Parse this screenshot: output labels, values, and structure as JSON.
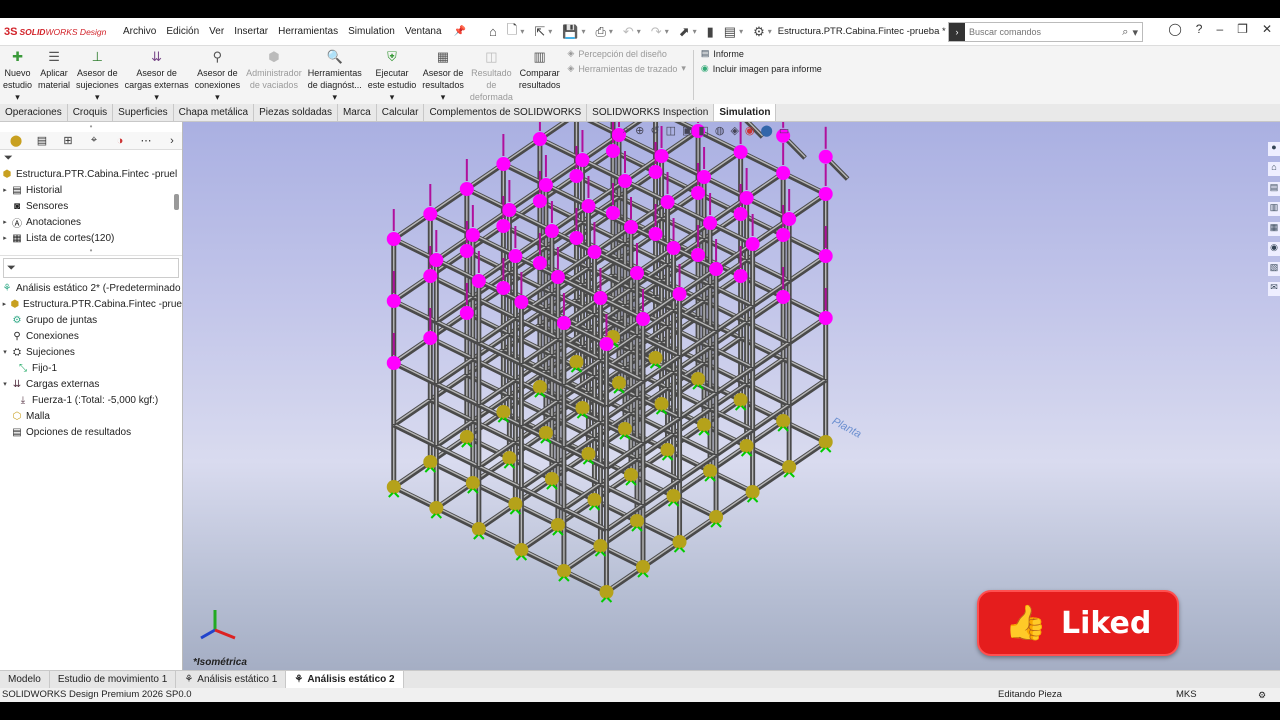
{
  "app": {
    "logo_ds": "3S",
    "logo_brand_bold": "SOLID",
    "logo_brand_rest": "WORKS Design",
    "document_title": "Estructura.PTR.Cabina.Fintec -prueba *"
  },
  "menu": [
    "Archivo",
    "Edición",
    "Ver",
    "Insertar",
    "Herramientas",
    "Simulation",
    "Ventana"
  ],
  "search": {
    "placeholder": "Buscar comandos"
  },
  "command_manager": {
    "buttons": [
      {
        "label": "Nuevo\nestudio",
        "icon": "new-study-icon",
        "disabled": false
      },
      {
        "label": "Aplicar\nmaterial",
        "icon": "apply-material-icon",
        "disabled": false
      },
      {
        "label": "Asesor de\nsujeciones",
        "icon": "fixtures-advisor-icon",
        "disabled": false
      },
      {
        "label": "Asesor de\ncargas externas",
        "icon": "external-loads-advisor-icon",
        "disabled": false
      },
      {
        "label": "Asesor de\nconexiones",
        "icon": "connections-advisor-icon",
        "disabled": false
      },
      {
        "label": "Administrador\nde vaciados",
        "icon": "shell-manager-icon",
        "disabled": true
      },
      {
        "label": "Herramientas\nde diagnóst...",
        "icon": "diagnostic-tools-icon",
        "disabled": false
      },
      {
        "label": "Ejecutar\neste estudio",
        "icon": "run-study-icon",
        "disabled": false
      },
      {
        "label": "Asesor de\nresultados",
        "icon": "results-advisor-icon",
        "disabled": false
      },
      {
        "label": "Resultado\nde\ndeformada",
        "icon": "deformed-result-icon",
        "disabled": true
      },
      {
        "label": "Comparar\nresultados",
        "icon": "compare-results-icon",
        "disabled": false
      }
    ],
    "small_disabled": [
      "Percepción del diseño",
      "Herramientas de trazado"
    ],
    "right_items": [
      "Informe",
      "Incluir imagen para informe"
    ]
  },
  "tabs": [
    "Operaciones",
    "Croquis",
    "Superficies",
    "Chapa metálica",
    "Piezas soldadas",
    "Marca",
    "Calcular",
    "Complementos de SOLIDWORKS",
    "SOLIDWORKS Inspection",
    "Simulation"
  ],
  "active_tab": "Simulation",
  "feature_tree": {
    "root": "Estructura.PTR.Cabina.Fintec -pruel",
    "items": [
      {
        "label": "Historial",
        "icon": "history-icon"
      },
      {
        "label": "Sensores",
        "icon": "sensors-icon"
      },
      {
        "label": "Anotaciones",
        "icon": "annotations-icon"
      },
      {
        "label": "Lista de cortes(120)",
        "icon": "cut-list-icon"
      }
    ]
  },
  "study_tree": {
    "root": "Análisis estático 2* (-Predeterminado",
    "items": [
      {
        "label": "Estructura.PTR.Cabina.Fintec -prue",
        "indent": 1,
        "arrow": true
      },
      {
        "label": "Grupo de juntas",
        "indent": 1,
        "arrow": false
      },
      {
        "label": "Conexiones",
        "indent": 1,
        "arrow": false
      },
      {
        "label": "Sujeciones",
        "indent": 1,
        "arrow": true
      },
      {
        "label": "Fijo-1",
        "indent": 2,
        "arrow": false
      },
      {
        "label": "Cargas externas",
        "indent": 1,
        "arrow": true
      },
      {
        "label": "Fuerza-1 (:Total: -5,000 kgf:)",
        "indent": 2,
        "arrow": false
      },
      {
        "label": "Malla",
        "indent": 1,
        "arrow": false
      },
      {
        "label": "Opciones de resultados",
        "indent": 1,
        "arrow": false
      }
    ]
  },
  "viewport": {
    "view_label": "*Isométrica",
    "plane_label": "Planta",
    "liked_text": "Liked"
  },
  "bottom_tabs": [
    "Modelo",
    "Estudio de movimiento 1",
    "Análisis estático 1",
    "Análisis estático 2"
  ],
  "active_bottom_tab": "Análisis estático 2",
  "status": {
    "version": "SOLIDWORKS Design Premium 2026 SP0.0",
    "mode": "Editando Pieza",
    "units": "MKS"
  },
  "colors": {
    "load_node": "#ff00ff",
    "fixture_node": "#b5a21a",
    "beam": "#4a4a4a",
    "liked_red": "#e51d1d"
  }
}
